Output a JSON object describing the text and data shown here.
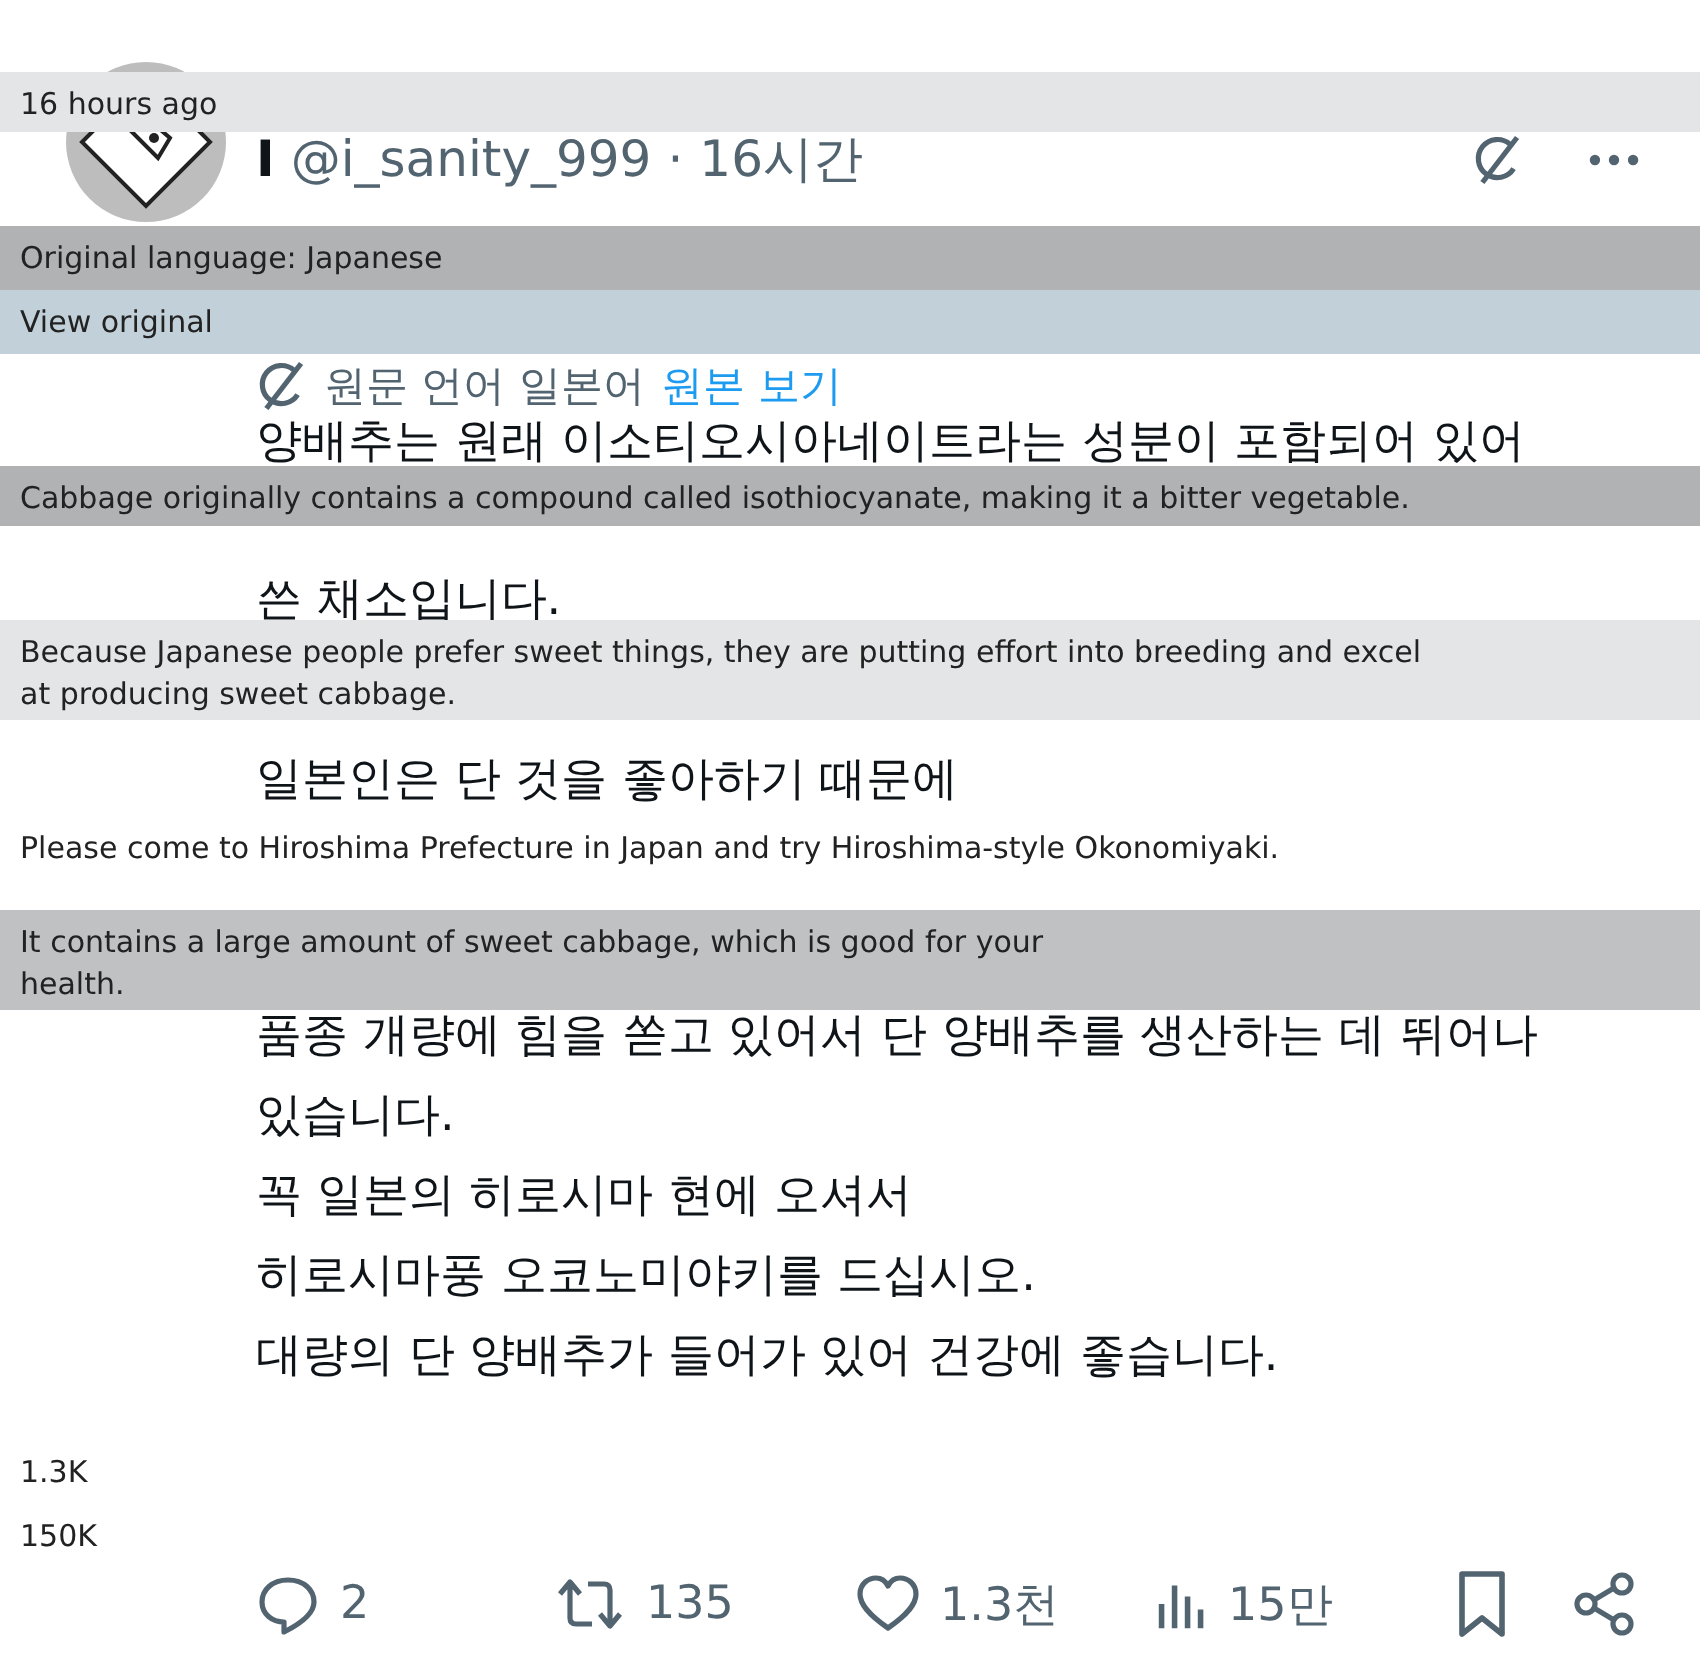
{
  "tweet": {
    "name": "I",
    "handle": "@i_sanity_999",
    "separator": "·",
    "time": "16시간",
    "translation_note": {
      "label": "원문 언어 일본어",
      "link": "원본 보기"
    },
    "body_lines": [
      "양배추는 원래 이소티오시아네이트라는 성분이 포함되어 있어",
      "쓴 채소입니다.",
      "일본인은 단 것을 좋아하기 때문에",
      "품종 개량에 힘을 쏟고 있어서 단 양배추를 생산하는 데 뛰어나",
      "있습니다.",
      "꼭 일본의 히로시마 현에 오셔서",
      "히로시마풍 오코노미야키를 드십시오.",
      "대량의 단 양배추가 들어가 있어 건강에 좋습니다."
    ],
    "actions": [
      {
        "kind": "reply",
        "count": "2"
      },
      {
        "kind": "repost",
        "count": "135"
      },
      {
        "kind": "like",
        "count": "1.3천"
      },
      {
        "kind": "views",
        "count": "15만"
      },
      {
        "kind": "bookmark"
      },
      {
        "kind": "share"
      }
    ]
  },
  "translation_overlays": [
    {
      "kind": "light",
      "text": "16 hours ago"
    },
    {
      "kind": "dark",
      "text": "Original language: Japanese"
    },
    {
      "kind": "blue",
      "text": "View original"
    },
    {
      "kind": "dark",
      "text": "Cabbage originally contains a compound called isothiocyanate, making it a bitter vegetable."
    },
    {
      "kind": "light",
      "text": "Because Japanese people prefer sweet things, they are putting effort into breeding and excel at producing sweet cabbage."
    },
    {
      "kind": "clear",
      "text": "Please come to Hiroshima Prefecture in Japan and try Hiroshima-style Okonomiyaki."
    },
    {
      "kind": "mid",
      "text": "It contains a large amount of sweet cabbage, which is good for your health."
    },
    {
      "kind": "clear",
      "text": "1.3K"
    },
    {
      "kind": "clear",
      "text": "150K"
    }
  ]
}
